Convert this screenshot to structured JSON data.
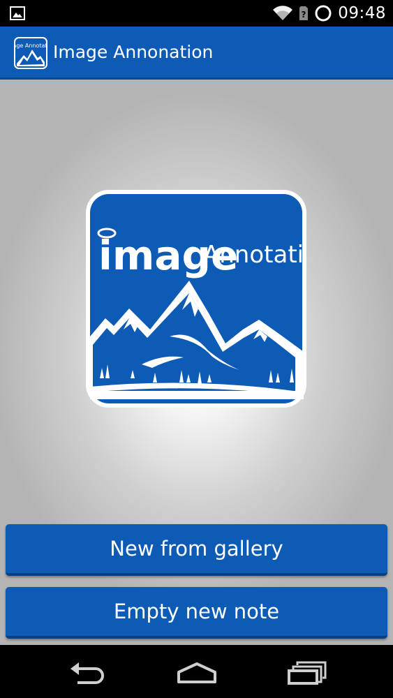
{
  "status_bar": {
    "time": "09:48",
    "icons": [
      "image-notification-icon",
      "wifi-icon",
      "no-sim-icon",
      "loading-circle-icon"
    ]
  },
  "action_bar": {
    "title": "Image Annonation",
    "icon": "app-logo-icon"
  },
  "logo": {
    "word1": "image",
    "word2": "Annotation"
  },
  "buttons": {
    "gallery": "New from gallery",
    "empty": "Empty new note"
  },
  "nav": {
    "back": "back-icon",
    "home": "home-icon",
    "recent": "recent-apps-icon"
  },
  "colors": {
    "primary": "#0d5bb4",
    "primary_dark": "#094a92",
    "status_bar": "#000000"
  }
}
